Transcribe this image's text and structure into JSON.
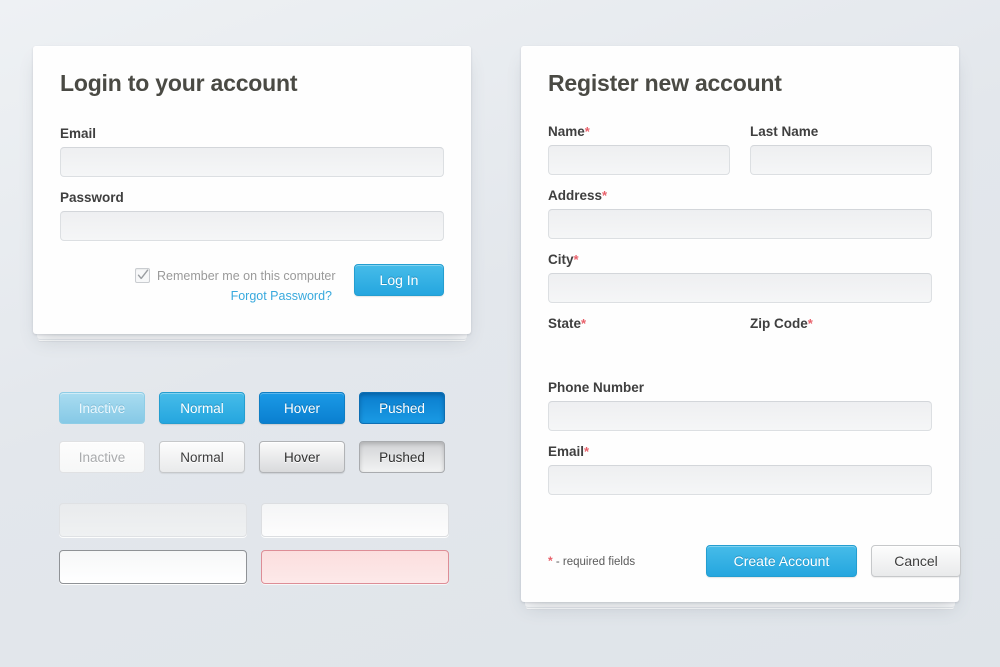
{
  "theme": {
    "background": "#e6eaee",
    "accent_blue": "#25a6df",
    "required_red": "#e8606a",
    "link_blue": "#38a9dd",
    "heading_color": "#4a4a44"
  },
  "login": {
    "title": "Login to your account",
    "fields": [
      {
        "label": "Email",
        "value": "",
        "placeholder": ""
      },
      {
        "label": "Password",
        "value": "",
        "placeholder": ""
      }
    ],
    "remember": {
      "label": "Remember me on this computer",
      "checked": true
    },
    "forgot_link": "Forgot Password?",
    "submit_label": "Log In"
  },
  "register": {
    "title": "Register new account",
    "required_marker": "*",
    "fields": {
      "name": {
        "label": "Name",
        "required": true,
        "value": "",
        "placeholder": ""
      },
      "last_name": {
        "label": "Last Name",
        "required": false,
        "value": "",
        "placeholder": ""
      },
      "address": {
        "label": "Address",
        "required": true,
        "value": "",
        "placeholder": ""
      },
      "city": {
        "label": "City",
        "required": true,
        "value": "",
        "placeholder": ""
      },
      "state": {
        "label": "State",
        "required": true,
        "value": "",
        "placeholder": ""
      },
      "zip_code": {
        "label": "Zip Code",
        "required": true,
        "value": "",
        "placeholder": ""
      },
      "phone_number": {
        "label": "Phone Number",
        "required": false,
        "value": "",
        "placeholder": ""
      },
      "email": {
        "label": "Email",
        "required": true,
        "value": "",
        "placeholder": ""
      }
    },
    "required_note": "- required fields",
    "create_label": "Create Account",
    "cancel_label": "Cancel"
  },
  "swatches": {
    "blue_buttons": [
      {
        "label": "Inactive",
        "state": "inactive"
      },
      {
        "label": "Normal",
        "state": "normal"
      },
      {
        "label": "Hover",
        "state": "hover"
      },
      {
        "label": "Pushed",
        "state": "pushed"
      }
    ],
    "grey_buttons": [
      {
        "label": "Inactive",
        "state": "inactive"
      },
      {
        "label": "Normal",
        "state": "normal"
      },
      {
        "label": "Hover",
        "state": "hover"
      },
      {
        "label": "Pushed",
        "state": "pushed"
      }
    ],
    "input_states": [
      {
        "state": "disabled",
        "value": "",
        "placeholder": ""
      },
      {
        "state": "normal",
        "value": "",
        "placeholder": ""
      },
      {
        "state": "focused",
        "value": "",
        "placeholder": ""
      },
      {
        "state": "error",
        "value": "",
        "placeholder": ""
      }
    ]
  }
}
